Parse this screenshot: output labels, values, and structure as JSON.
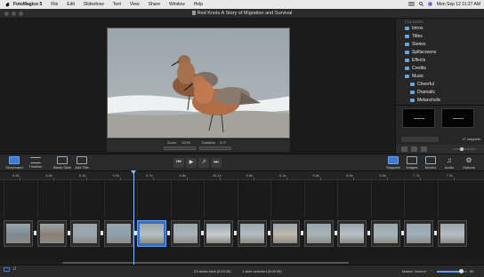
{
  "menubar": {
    "app_name": "FotoMagico 5",
    "items": [
      "File",
      "Edit",
      "Slideshow",
      "Text",
      "View",
      "Share",
      "Window",
      "Help"
    ],
    "datetime": "Mon Sep 12  11:27 AM"
  },
  "window": {
    "title": "Red Knots A Story of Migration and Survival"
  },
  "preview": {
    "zoom_label": "Zoom",
    "zoom_value": "120%",
    "rotation_label": "Rotation",
    "rotation_value": "0.0°"
  },
  "sidebar": {
    "header": "FOLDERS",
    "folders": [
      "Intros",
      "Titles",
      "Stories",
      "Splitscreens",
      "Effects",
      "Credits",
      "Music"
    ],
    "subfolders": [
      "Cheerful",
      "Dramatic",
      "Melancholic"
    ],
    "snippet_count": "17 snippets"
  },
  "toolbar": {
    "left_buttons": [
      "Storyboard",
      "Timeline",
      "Blank Slide",
      "Add Title"
    ],
    "right_buttons": [
      "Snippets",
      "Images",
      "Movies",
      "Audio",
      "Options"
    ],
    "playback_icons": [
      "skip-back",
      "play",
      "share",
      "skip-forward"
    ]
  },
  "timeline": {
    "ruler_labels": [
      "6.8s",
      "6.8s",
      "6.4s",
      "5.9s",
      "5.7s",
      "6.8s",
      "26.1s",
      "6.8s",
      "6.4s",
      "6.8s",
      "6.8s",
      "6.8s",
      "7.7s",
      "7.2s"
    ],
    "clip_count": 14,
    "selected_clip": 4
  },
  "status": {
    "summary": "23 slides total (0:03:28)",
    "selection": "1 slide selected (0:00:05)",
    "volume_label": "Master Volume:",
    "volume_value": "80",
    "volume_level": 0.8
  },
  "colors": {
    "accent": "#3a7bd5",
    "folder_icon": "#5aa9e6",
    "playhead": "#8bbcff"
  }
}
